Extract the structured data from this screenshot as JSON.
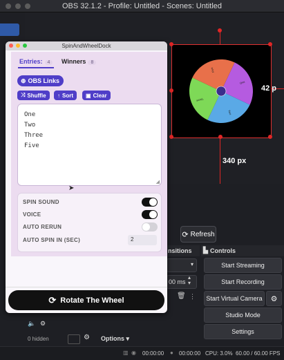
{
  "obs": {
    "window_title": "OBS 32.1.2 - Profile: Untitled - Scenes: Untitled",
    "preview": {
      "width_label": "340 px",
      "height_label": "42 p"
    },
    "refresh_label": "Refresh",
    "transitions_header": "nsitions",
    "transition_duration": "00 ms",
    "controls_header": "Controls",
    "controls": {
      "start_streaming": "Start Streaming",
      "start_recording": "Start Recording",
      "start_virtual_camera": "Start Virtual Camera",
      "studio_mode": "Studio Mode",
      "settings": "Settings"
    },
    "mixer": {
      "hidden_label": "0 hidden",
      "options_label": "Options"
    },
    "status": {
      "time1": "00:00:00",
      "time2": "00:00:00",
      "cpu": "CPU: 3.0%",
      "fps": "60.00 / 60.00 FPS"
    }
  },
  "dock": {
    "title": "SpinAndWheelDock",
    "tabs": {
      "entries_label": "Entries:",
      "entries_count": "4",
      "winners_label": "Winners",
      "winners_count": "8"
    },
    "obs_links_label": "OBS Links",
    "shuffle_label": "Shuffle",
    "sort_label": "Sort",
    "clear_label": "Clear",
    "entries": [
      "One",
      "Two",
      "Three",
      "Five"
    ],
    "settings": {
      "spin_sound_label": "SPIN SOUND",
      "spin_sound_on": true,
      "voice_label": "VOICE",
      "voice_on": true,
      "auto_rerun_label": "AUTO RERUN",
      "auto_rerun_on": false,
      "auto_spin_label": "AUTO SPIN IN (SEC)",
      "auto_spin_value": "2"
    },
    "rotate_label": "Rotate The Wheel"
  },
  "wheel": {
    "slices": [
      {
        "label": "One",
        "color": "#b55be0"
      },
      {
        "label": "Two",
        "color": "#5aa9e6"
      },
      {
        "label": "Three",
        "color": "#7ed957"
      },
      {
        "label": "Five",
        "color": "#e8704a"
      }
    ]
  }
}
